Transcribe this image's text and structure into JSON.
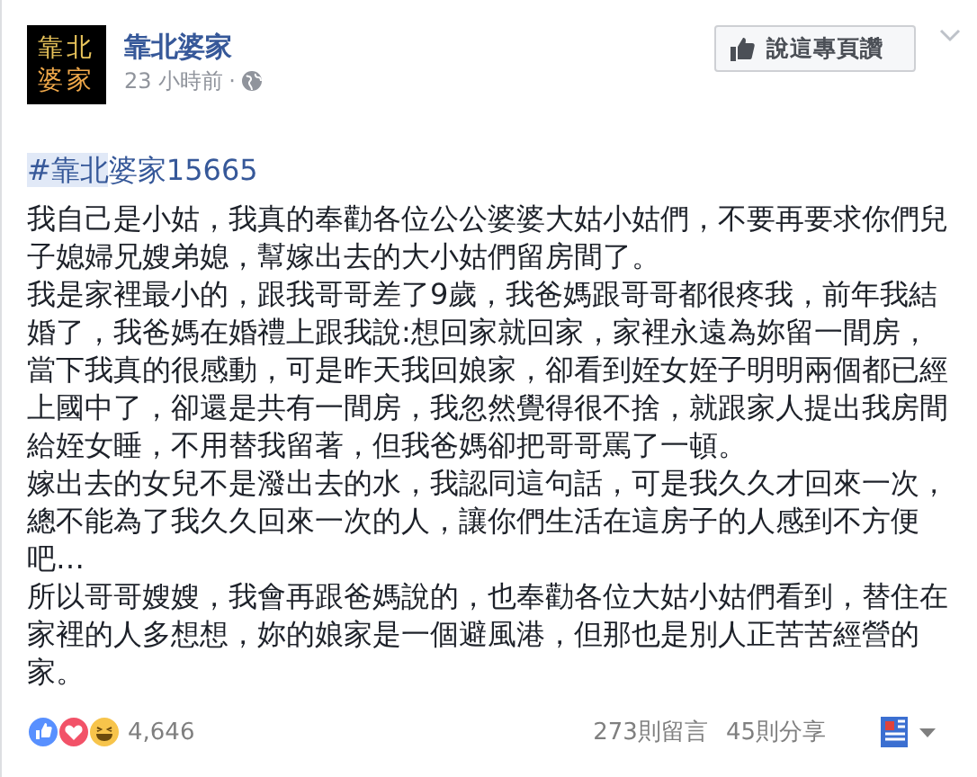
{
  "page": {
    "name": "靠北婆家",
    "avatar_text": [
      "靠北",
      "婆家"
    ],
    "time": "23 小時前",
    "separator": "·",
    "like_button": "說這專頁讚"
  },
  "hashtag": [
    {
      "text": "#靠北",
      "highlighted": true
    },
    {
      "text": "婆家15665",
      "highlighted": false
    }
  ],
  "paragraphs": [
    "我自己是小姑，我真的奉勸各位公公婆婆大姑小姑們，不要再要求你們兒子媳婦兄嫂弟媳，幫嫁出去的大小姑們留房間了。",
    "我是家裡最小的，跟我哥哥差了9歲，我爸媽跟哥哥都很疼我，前年我結婚了，我爸媽在婚禮上跟我說:想回家就回家，家裡永遠為妳留一間房，當下我真的很感動，可是昨天我回娘家，卻看到姪女姪子明明兩個都已經上國中了，卻還是共有一間房，我忽然覺得很不捨，就跟家人提出我房間給姪女睡，不用替我留著，但我爸媽卻把哥哥罵了一頓。",
    "嫁出去的女兒不是潑出去的水，我認同這句話，可是我久久才回來一次，總不能為了我久久回來一次的人，讓你們生活在這房子的人感到不方便吧…",
    "所以哥哥嫂嫂，我會再跟爸媽說的，也奉勸各位大姑小姑們看到，替住在家裡的人多想想，妳的娘家是一個避風港，但那也是別人正苦苦經營的家。"
  ],
  "footer": {
    "reactions": [
      {
        "kind": "like"
      },
      {
        "kind": "love"
      },
      {
        "kind": "haha"
      }
    ],
    "reaction_count": "4,646",
    "comments": "273則留言",
    "shares": "45則分享"
  }
}
